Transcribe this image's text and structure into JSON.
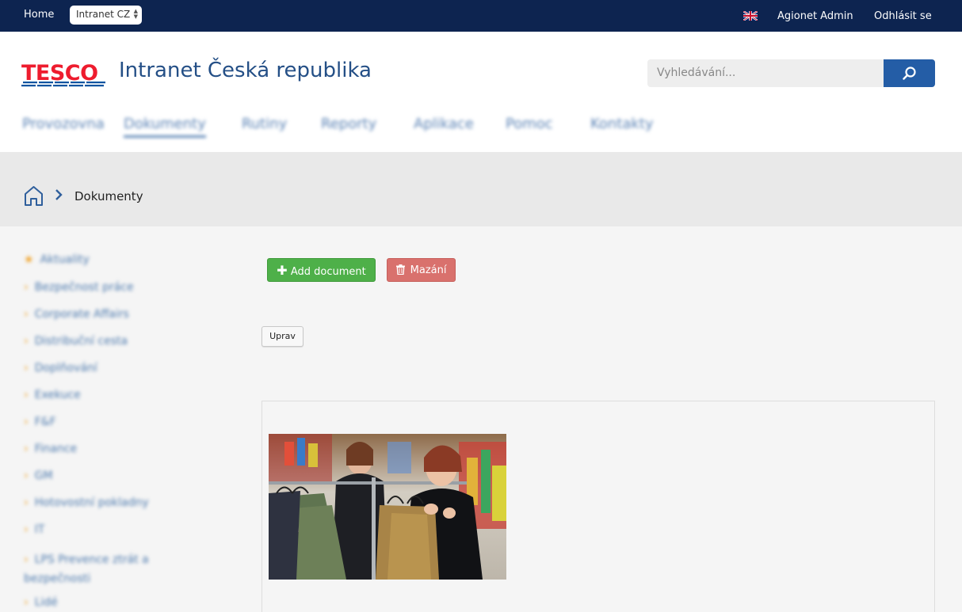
{
  "topbar": {
    "home_label": "Home",
    "site_select_value": "Intranet CZ",
    "language_flag_icon": "uk-flag-icon",
    "user_name": "Agionet Admin",
    "logout_label": "Odhlásit se"
  },
  "header": {
    "logo_text": "TESCO",
    "site_title": "Intranet Česká republika",
    "search_placeholder": "Vyhledávání...",
    "search_icon": "search-icon"
  },
  "nav": {
    "items": [
      "Provozovna",
      "Dokumenty",
      "Rutiny",
      "Reporty",
      "Aplikace",
      "Pomoc",
      "Kontakty"
    ]
  },
  "breadcrumb": {
    "home_icon": "home-icon",
    "current": "Dokumenty"
  },
  "sidebar": {
    "items": [
      "Aktuality",
      "Bezpečnost práce",
      "Corporate Affairs",
      "Distribuční cesta",
      "Doplňování",
      "Exekuce",
      "F&F",
      "Finance",
      "GM",
      "Hotovostní pokladny",
      "IT",
      "LPS Prevence ztrát a bezpečnosti",
      "Lidé"
    ]
  },
  "main": {
    "add_button_label": "Add document",
    "delete_button_label": "Mazání",
    "edit_button_label": "Uprav"
  },
  "colors": {
    "topbar": "#0d2450",
    "accent": "#245da6",
    "add_button": "#4eb049",
    "delete_button": "#d9716d"
  }
}
